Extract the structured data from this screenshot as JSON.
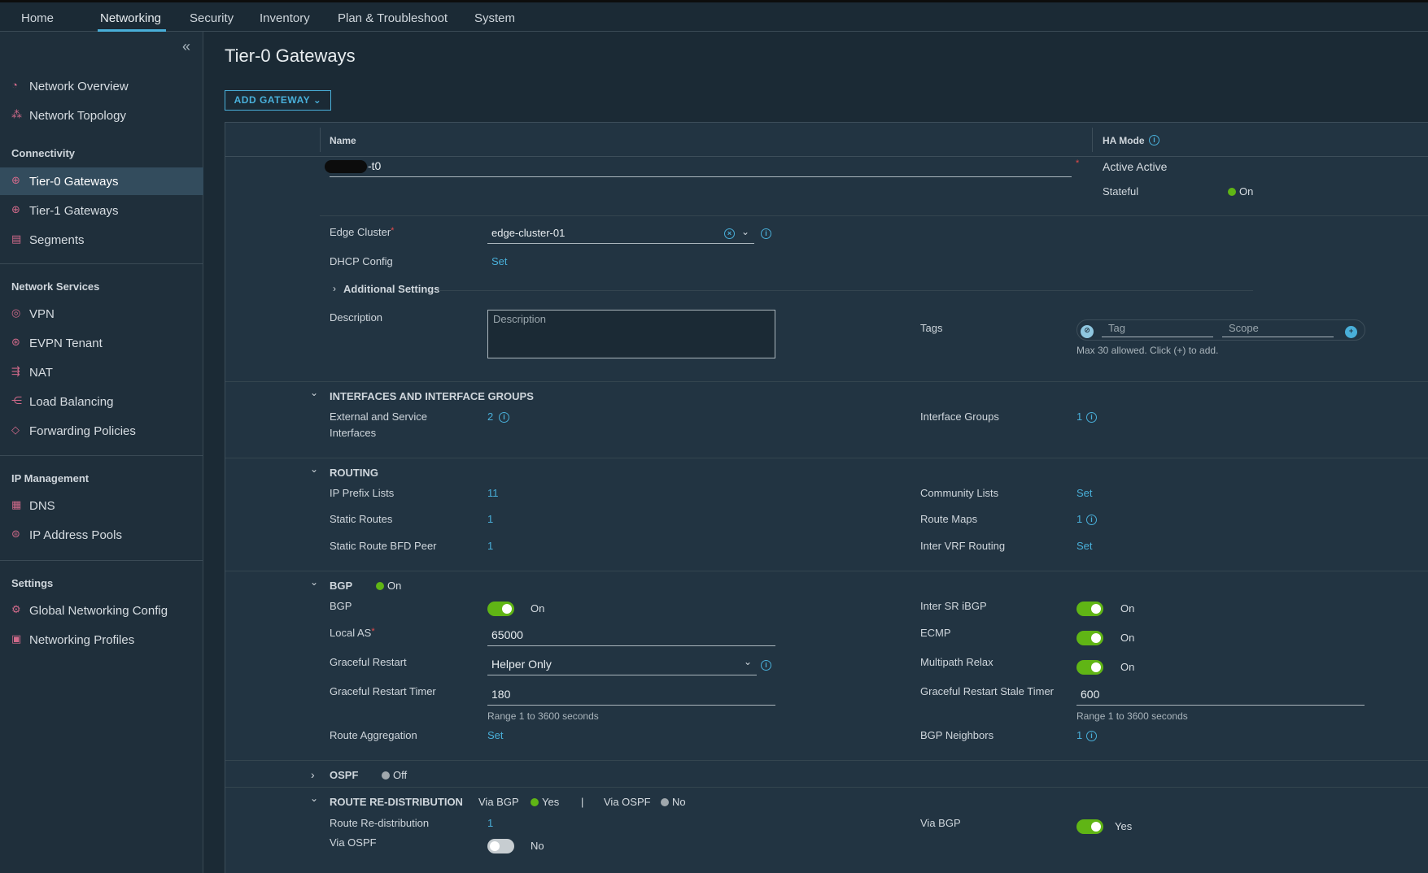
{
  "topnav": {
    "tabs": [
      {
        "label": "Home"
      },
      {
        "label": "Networking"
      },
      {
        "label": "Security"
      },
      {
        "label": "Inventory"
      },
      {
        "label": "Plan & Troubleshoot"
      },
      {
        "label": "System"
      }
    ],
    "active": "Networking"
  },
  "sidebar": {
    "collapse_icon": "double-chevron-left-icon",
    "top_items": [
      {
        "label": "Network Overview",
        "icon": "gauge-icon"
      },
      {
        "label": "Network Topology",
        "icon": "topology-icon"
      }
    ],
    "sections": [
      {
        "title": "Connectivity",
        "items": [
          {
            "label": "Tier-0 Gateways",
            "icon": "gateway-icon",
            "active": true
          },
          {
            "label": "Tier-1 Gateways",
            "icon": "gateway-icon"
          },
          {
            "label": "Segments",
            "icon": "segments-icon"
          }
        ]
      },
      {
        "title": "Network Services",
        "items": [
          {
            "label": "VPN",
            "icon": "vpn-icon"
          },
          {
            "label": "EVPN Tenant",
            "icon": "evpn-icon"
          },
          {
            "label": "NAT",
            "icon": "nat-icon"
          },
          {
            "label": "Load Balancing",
            "icon": "load-balancer-icon"
          },
          {
            "label": "Forwarding Policies",
            "icon": "forwarding-icon"
          }
        ]
      },
      {
        "title": "IP Management",
        "items": [
          {
            "label": "DNS",
            "icon": "dns-icon"
          },
          {
            "label": "IP Address Pools",
            "icon": "ip-pool-icon"
          }
        ]
      },
      {
        "title": "Settings",
        "items": [
          {
            "label": "Global Networking Config",
            "icon": "global-config-icon"
          },
          {
            "label": "Networking Profiles",
            "icon": "profile-icon"
          }
        ]
      }
    ]
  },
  "page": {
    "title": "Tier-0 Gateways",
    "add_button": "ADD GATEWAY",
    "columns": {
      "name": "Name",
      "ha_mode": "HA Mode"
    }
  },
  "gateway": {
    "name_suffix": "-t0",
    "ha_mode": "Active Active",
    "stateful_label": "Stateful",
    "stateful_value": "On",
    "edge_cluster_label": "Edge Cluster",
    "edge_cluster_value": "edge-cluster-01",
    "dhcp_label": "DHCP Config",
    "dhcp_value": "Set",
    "additional_settings": "Additional Settings",
    "description_label": "Description",
    "description_placeholder": "Description",
    "tags_label": "Tags",
    "tag_placeholder": "Tag",
    "scope_placeholder": "Scope",
    "tags_hint": "Max 30 allowed. Click (+) to add."
  },
  "interfaces": {
    "title": "INTERFACES AND INTERFACE GROUPS",
    "ext_label_1": "External and Service",
    "ext_label_2": "Interfaces",
    "ext_value": "2",
    "groups_label": "Interface Groups",
    "groups_value": "1"
  },
  "routing": {
    "title": "ROUTING",
    "ip_prefix_label": "IP Prefix Lists",
    "ip_prefix_value": "11",
    "community_label": "Community Lists",
    "community_value": "Set",
    "static_routes_label": "Static Routes",
    "static_routes_value": "1",
    "route_maps_label": "Route Maps",
    "route_maps_value": "1",
    "bfd_label": "Static Route BFD Peer",
    "bfd_value": "1",
    "inter_vrf_label": "Inter VRF Routing",
    "inter_vrf_value": "Set"
  },
  "bgp": {
    "title": "BGP",
    "status": "On",
    "bgp_label": "BGP",
    "bgp_value": "On",
    "inter_sr_label": "Inter SR iBGP",
    "inter_sr_value": "On",
    "local_as_label": "Local AS",
    "local_as_value": "65000",
    "ecmp_label": "ECMP",
    "ecmp_value": "On",
    "graceful_label": "Graceful Restart",
    "graceful_value": "Helper Only",
    "multipath_label": "Multipath Relax",
    "multipath_value": "On",
    "gr_timer_label": "Graceful Restart Timer",
    "gr_timer_value": "180",
    "gr_timer_hint": "Range 1 to 3600 seconds",
    "gr_stale_label": "Graceful Restart Stale Timer",
    "gr_stale_value": "600",
    "gr_stale_hint": "Range 1 to 3600 seconds",
    "aggregation_label": "Route Aggregation",
    "aggregation_value": "Set",
    "neighbors_label": "BGP Neighbors",
    "neighbors_value": "1"
  },
  "ospf": {
    "title": "OSPF",
    "status": "Off"
  },
  "redistribution": {
    "title": "ROUTE RE-DISTRIBUTION",
    "via_bgp_label": "Via BGP",
    "via_bgp_status": "Yes",
    "separator": "|",
    "via_ospf_label": "Via OSPF",
    "via_ospf_status": "No",
    "route_redist_label": "Route Re-distribution",
    "route_redist_value": "1",
    "via_bgp_row_label": "Via BGP",
    "via_bgp_row_value": "Yes",
    "via_ospf_row_label": "Via OSPF",
    "via_ospf_row_value": "No"
  },
  "colors": {
    "accent": "#49afd9",
    "on": "#60b515",
    "required": "#e64a4a"
  }
}
